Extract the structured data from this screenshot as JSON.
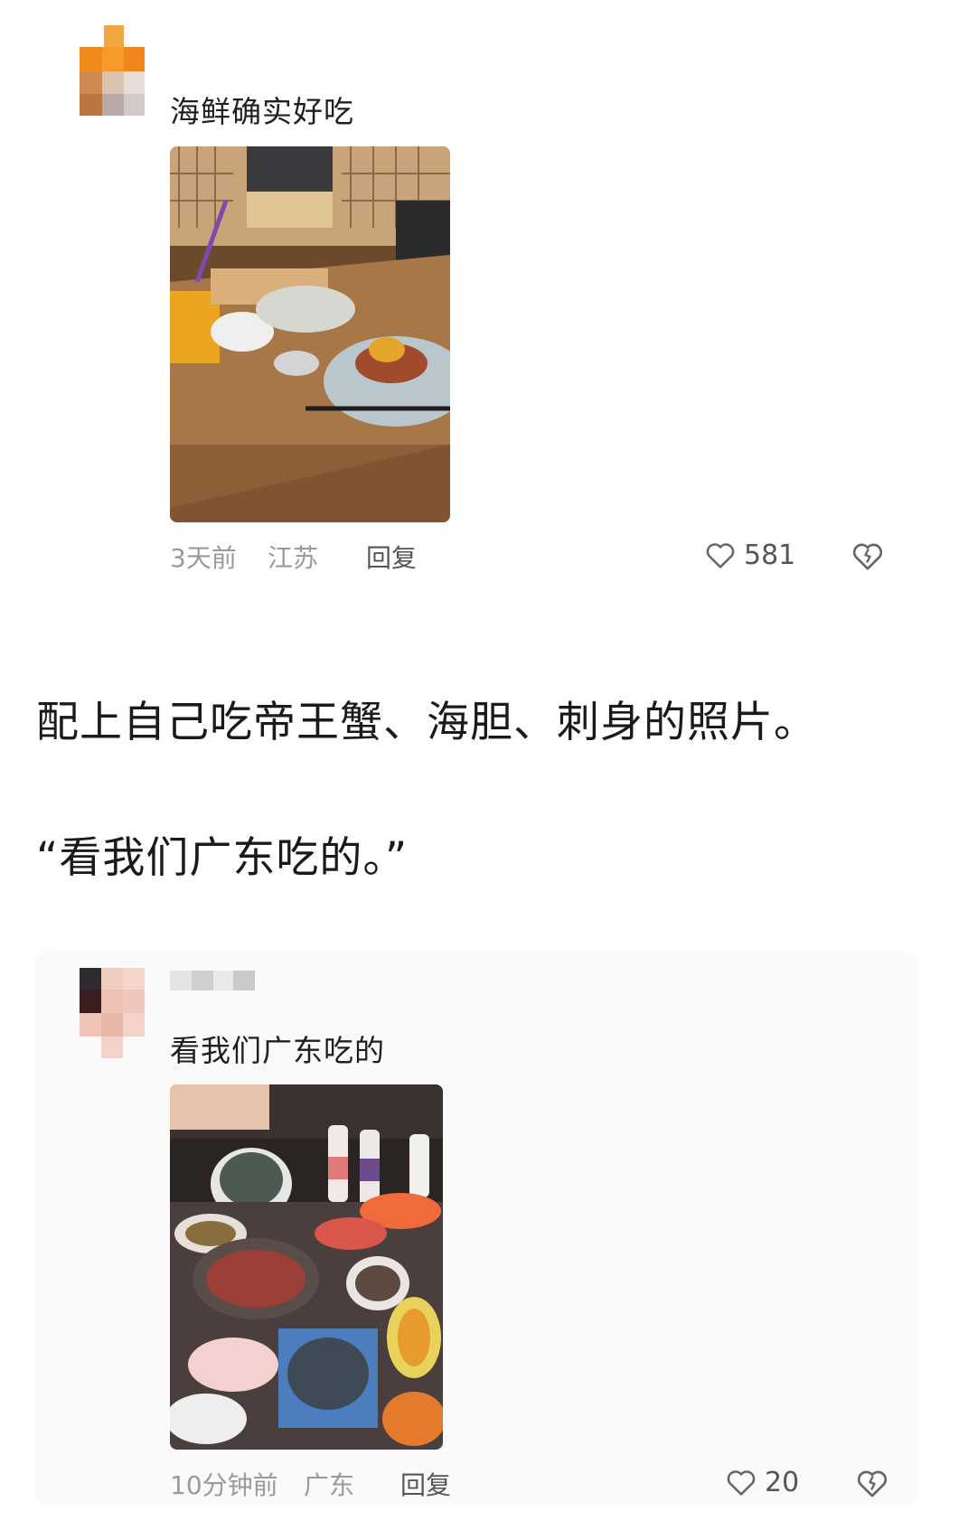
{
  "comment1": {
    "text": "海鲜确实好吃",
    "time": "3天前",
    "location": "江苏",
    "reply_label": "回复",
    "likes": "581"
  },
  "article": {
    "paragraph1": "配上自己吃帝王蟹、海胆、刺身的照片。",
    "paragraph2": "“看我们广东吃的。”"
  },
  "comment2": {
    "text": "看我们广东吃的",
    "time": "10分钟前",
    "location": "广东",
    "reply_label": "回复",
    "likes": "20"
  },
  "icons": {
    "like": "heart-outline-icon",
    "dislike": "broken-heart-icon"
  },
  "colors": {
    "avatar1_orange": "#f08a1c",
    "avatar1_brown": "#b9773f",
    "meta_gray": "#9a9a9a"
  }
}
